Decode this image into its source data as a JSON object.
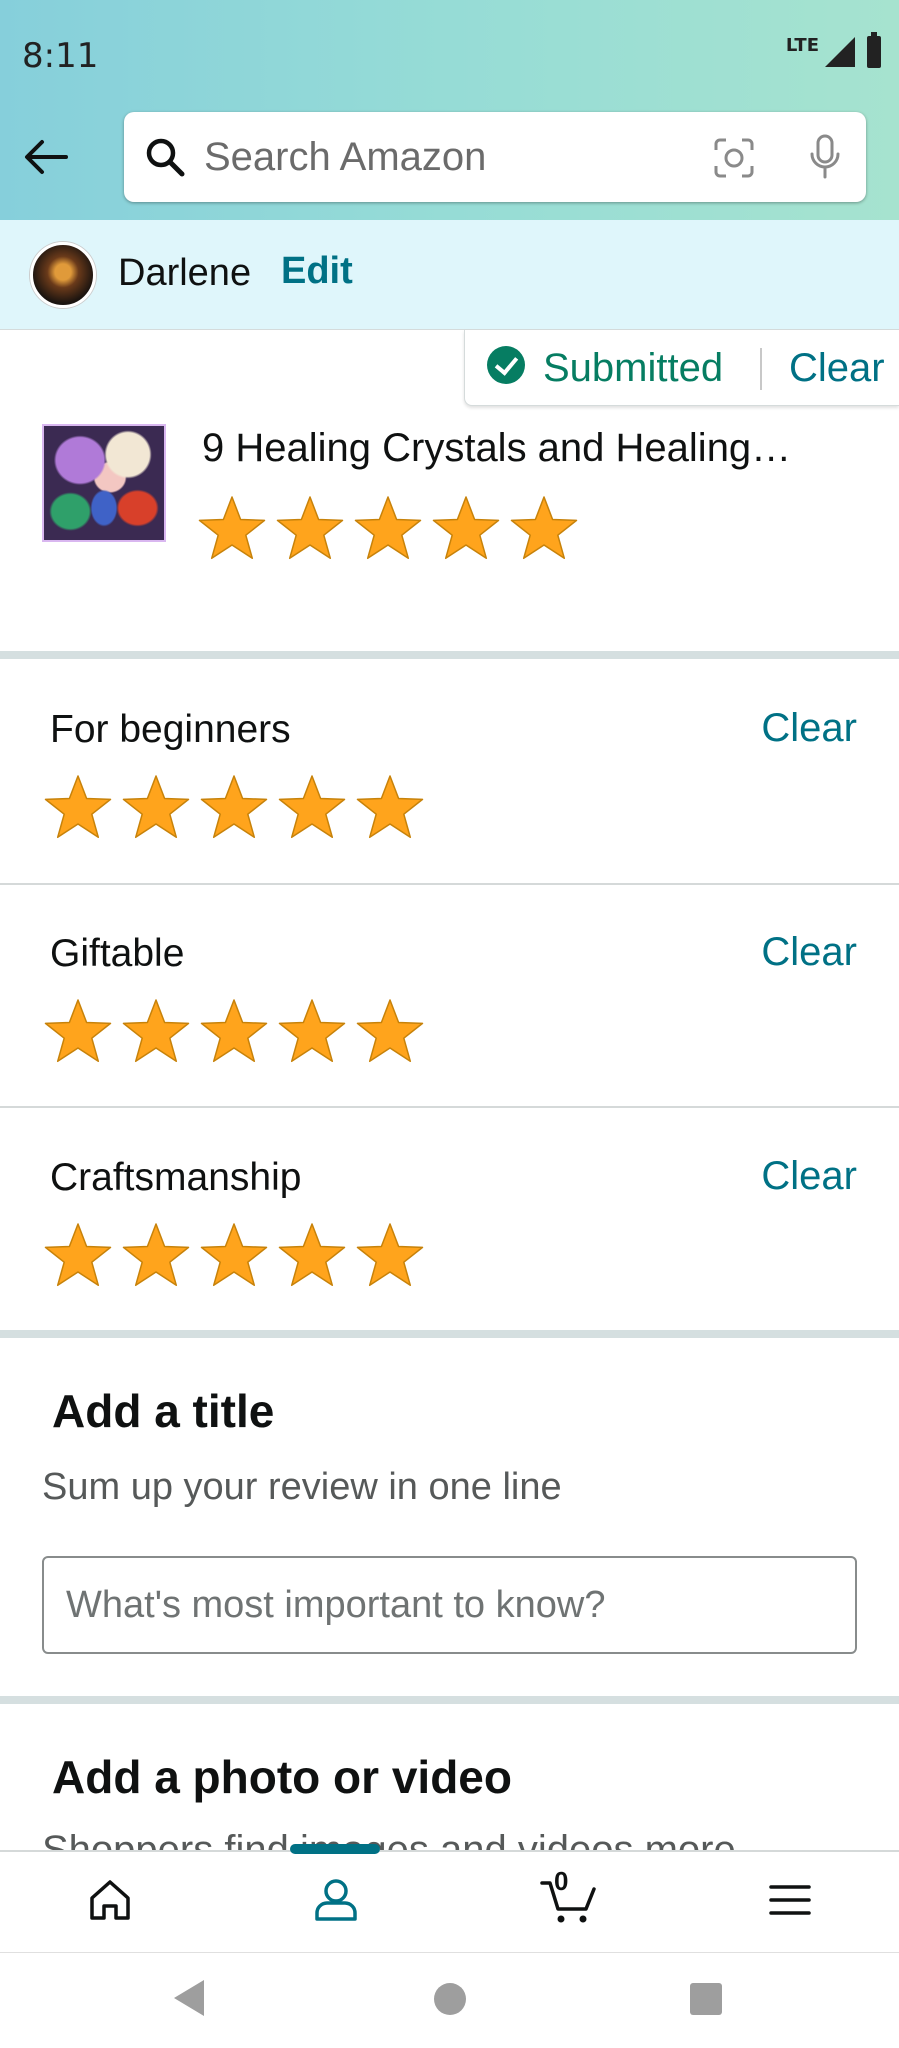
{
  "status_bar": {
    "time": "8:11",
    "network": "LTE"
  },
  "search": {
    "placeholder": "Search Amazon"
  },
  "user": {
    "name": "Darlene",
    "edit_label": "Edit"
  },
  "submission": {
    "status_label": "Submitted",
    "clear_label": "Clear"
  },
  "product": {
    "title": "9 Healing Crystals and Healing…",
    "rating": 5,
    "max_rating": 5
  },
  "attributes": [
    {
      "label": "For beginners",
      "clear_label": "Clear",
      "rating": 5
    },
    {
      "label": "Giftable",
      "clear_label": "Clear",
      "rating": 5
    },
    {
      "label": "Craftsmanship",
      "clear_label": "Clear",
      "rating": 5
    }
  ],
  "title_section": {
    "heading": "Add a title",
    "subheading": "Sum up your review in one line",
    "input_placeholder": "What's most important to know?",
    "input_value": ""
  },
  "photo_section": {
    "heading": "Add a photo or video",
    "subheading_partial": "Shoppers find images and videos more"
  },
  "bottom_nav": {
    "items": [
      {
        "icon": "home-icon",
        "active": false
      },
      {
        "icon": "account-icon",
        "active": true
      },
      {
        "icon": "cart-icon",
        "active": false,
        "count": "0"
      },
      {
        "icon": "menu-icon",
        "active": false
      }
    ]
  },
  "colors": {
    "link": "#007185",
    "success": "#067D62",
    "star": "#FFA41C",
    "header_gradient_start": "#86cfdb",
    "header_gradient_end": "#a6e3cf",
    "userbar_bg": "#dff6fb"
  }
}
